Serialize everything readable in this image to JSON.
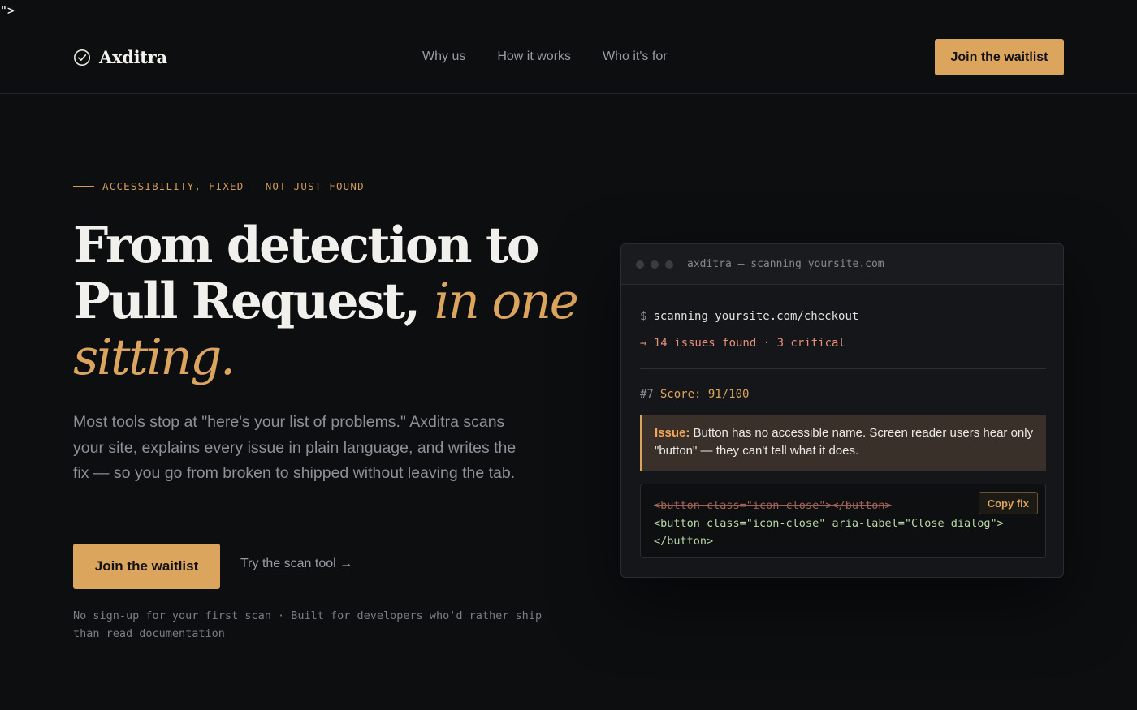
{
  "stray_text": "\">",
  "brand": {
    "name": "Axditra",
    "icon": "check-circle-icon"
  },
  "nav": {
    "items": [
      "Why us",
      "How it works",
      "Who it's for"
    ],
    "cta": "Join the waitlist"
  },
  "hero": {
    "eyebrow": "ACCESSIBILITY, FIXED — NOT JUST FOUND",
    "headline_plain": "From detection to Pull Request,",
    "headline_accent": "in one sitting.",
    "lede": "Most tools stop at \"here's your list of problems.\" Axditra scans your site, explains every issue in plain language, and writes the fix — so you go from broken to shipped without leaving the tab.",
    "cta_primary": "Join the waitlist",
    "cta_secondary": "Try the scan tool →",
    "fineprint": "No sign-up for your first scan · Built for developers who'd rather ship than read documentation"
  },
  "terminal": {
    "title": "axditra — scanning yoursite.com",
    "prompt": "$",
    "command": "scanning yoursite.com/checkout",
    "result": "→ 14 issues found · 3 critical",
    "issue_number": "#7",
    "score": "Score: 91/100",
    "issue_label": "Issue:",
    "issue_text": "Button has no accessible name. Screen reader users hear only \"button\" — they can't tell what it does.",
    "code_old": "<button class=\"icon-close\"></button>",
    "code_new": "<button class=\"icon-close\" aria-label=\"Close dialog\">",
    "code_new_end": "</button>",
    "copy_label": "Copy fix"
  },
  "colors": {
    "background": "#0d0e10",
    "accent": "#dca55e",
    "critical": "#e48f7b",
    "code_added": "#b8d8a8"
  }
}
